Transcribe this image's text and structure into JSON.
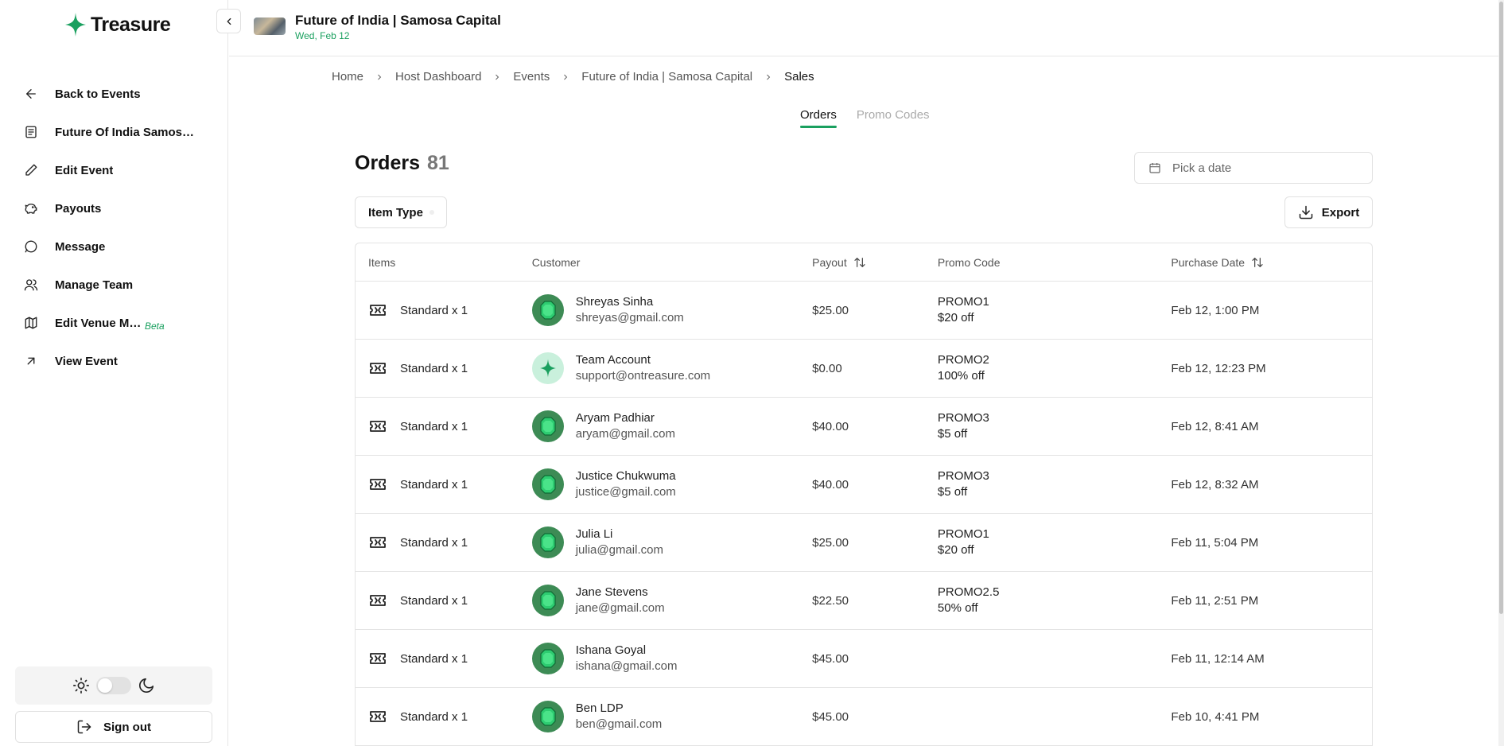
{
  "sidebar": {
    "logo_text": "Treasure",
    "items": [
      {
        "label": "Back to Events",
        "icon": "arrow-left-icon"
      },
      {
        "label": "Future Of India Samosa ...",
        "icon": "document-icon"
      },
      {
        "label": "Edit Event",
        "icon": "pencil-icon"
      },
      {
        "label": "Payouts",
        "icon": "piggy-bank-icon"
      },
      {
        "label": "Message",
        "icon": "message-icon"
      },
      {
        "label": "Manage Team",
        "icon": "users-icon"
      },
      {
        "label": "Edit Venue Map",
        "icon": "map-icon",
        "badge": "Beta"
      },
      {
        "label": "View Event",
        "icon": "arrow-up-right-icon"
      }
    ],
    "sign_out_label": "Sign out"
  },
  "header": {
    "event_title": "Future of India | Samosa Capital",
    "event_date": "Wed, Feb 12"
  },
  "breadcrumb": [
    "Home",
    "Host Dashboard",
    "Events",
    "Future of India | Samosa Capital",
    "Sales"
  ],
  "tabs": [
    {
      "label": "Orders",
      "active": true
    },
    {
      "label": "Promo Codes",
      "active": false
    }
  ],
  "orders": {
    "title": "Orders",
    "count": "81",
    "date_placeholder": "Pick a date",
    "filter_label": "Item Type",
    "export_label": "Export"
  },
  "table": {
    "columns": [
      "Items",
      "Customer",
      "Payout",
      "Promo Code",
      "Purchase Date"
    ],
    "rows": [
      {
        "item": "Standard x 1",
        "name": "Shreyas Sinha",
        "email": "shreyas@gmail.com",
        "payout": "$25.00",
        "promo": "PROMO1",
        "promo_desc": "$20 off",
        "date": "Feb 12, 1:00 PM",
        "avatar": "emerald"
      },
      {
        "item": "Standard x 1",
        "name": "Team Account",
        "email": "support@ontreasure.com",
        "payout": "$0.00",
        "promo": "PROMO2",
        "promo_desc": "100% off",
        "date": "Feb 12, 12:23 PM",
        "avatar": "team"
      },
      {
        "item": "Standard x 1",
        "name": "Aryam Padhiar",
        "email": "aryam@gmail.com",
        "payout": "$40.00",
        "promo": "PROMO3",
        "promo_desc": "$5 off",
        "date": "Feb 12, 8:41 AM",
        "avatar": "emerald"
      },
      {
        "item": "Standard x 1",
        "name": "Justice Chukwuma",
        "email": "justice@gmail.com",
        "payout": "$40.00",
        "promo": "PROMO3",
        "promo_desc": "$5 off",
        "date": "Feb 12, 8:32 AM",
        "avatar": "emerald"
      },
      {
        "item": "Standard x 1",
        "name": "Julia Li",
        "email": "julia@gmail.com",
        "payout": "$25.00",
        "promo": "PROMO1",
        "promo_desc": "$20 off",
        "date": "Feb 11, 5:04 PM",
        "avatar": "emerald"
      },
      {
        "item": "Standard x 1",
        "name": "Jane Stevens",
        "email": "jane@gmail.com",
        "payout": "$22.50",
        "promo": "PROMO2.5",
        "promo_desc": "50% off",
        "date": "Feb 11, 2:51 PM",
        "avatar": "emerald"
      },
      {
        "item": "Standard x 1",
        "name": "Ishana Goyal",
        "email": "ishana@gmail.com",
        "payout": "$45.00",
        "promo": "",
        "promo_desc": "",
        "date": "Feb 11, 12:14 AM",
        "avatar": "emerald"
      },
      {
        "item": "Standard x 1",
        "name": "Ben LDP",
        "email": "ben@gmail.com",
        "payout": "$45.00",
        "promo": "",
        "promo_desc": "",
        "date": "Feb 10, 4:41 PM",
        "avatar": "emerald"
      }
    ]
  },
  "colors": {
    "accent": "#1aa05f",
    "avatar_bg": "#3d8b55",
    "team_avatar_bg": "#c9f0dc"
  }
}
